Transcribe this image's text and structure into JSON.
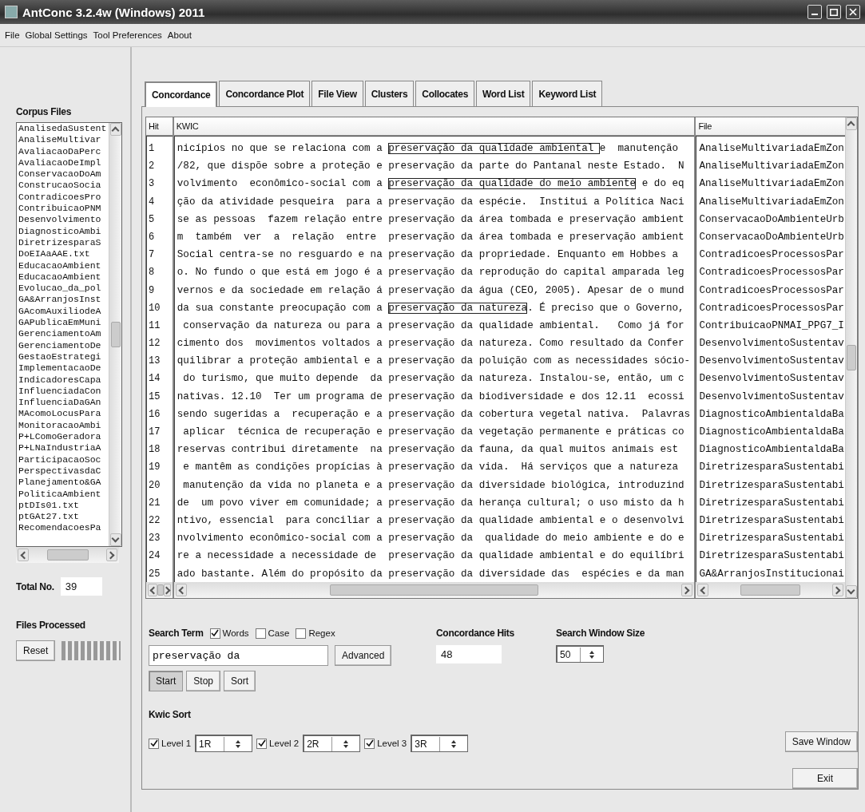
{
  "window": {
    "title": "AntConc 3.2.4w (Windows) 2011"
  },
  "menu": [
    "File",
    "Global Settings",
    "Tool Preferences",
    "About"
  ],
  "corpus": {
    "title": "Corpus Files",
    "files": [
      "AnalisedaSustent",
      "AnaliseMultivar",
      "AvaliacaoDaPerc",
      "AvaliacaoDeImpl",
      "ConservacaoDoAm",
      "ConstrucaoSocia",
      "ContradicoesPro",
      "ContribuicaoPNM",
      "Desenvolvimento",
      "DiagnosticoAmbi",
      "DiretrizesparaS",
      "DoEIAaAAE.txt",
      "EducacaoAmbient",
      "EducacaoAmbient",
      "Evolucao_da_pol",
      "GA&ArranjosInst",
      "GAcomAuxiliodeA",
      "GAPublicaEmMuni",
      "GerenciamentoAm",
      "GerenciamentoDe",
      "GestaoEstrategi",
      "ImplementacaoDe",
      "IndicadoresCapa",
      "InfluenciadaCon",
      "InfluenciaDaGAn",
      "MAcomoLocusPara",
      "MonitoracaoAmbi",
      "P+LComoGeradora",
      "P+LNaIndustriaA",
      "ParticipacaoSoc",
      "PerspectivasdaC",
      "Planejamento&GA",
      "PoliticaAmbient",
      "ptDIs01.txt",
      "ptGAt27.txt",
      "RecomendacoesPa"
    ],
    "total_label": "Total No.",
    "total": "39",
    "processed_label": "Files Processed",
    "reset": "Reset",
    "processed": {
      "level": 1
    }
  },
  "tabs": [
    {
      "label": "Concordance",
      "selected": true
    },
    {
      "label": "Concordance Plot",
      "selected": false
    },
    {
      "label": "File View",
      "selected": false
    },
    {
      "label": "Clusters",
      "selected": false
    },
    {
      "label": "Collocates",
      "selected": false
    },
    {
      "label": "Word List",
      "selected": false
    },
    {
      "label": "Keyword List",
      "selected": false
    }
  ],
  "table": {
    "columns": [
      "Hit",
      "KWIC",
      "File"
    ],
    "rows": [
      {
        "hit": "1",
        "left": "nicípios no que se relaciona com a ",
        "node": "preservação da qualidade ambiental ",
        "right": "e  manutenção",
        "boxed": true,
        "file": "AnaliseMultivariadaEmZon"
      },
      {
        "hit": "2",
        "left": "/82, que dispõe sobre a proteção e ",
        "node": "preservação da",
        "right": " parte do Pantanal neste Estado.  N",
        "boxed": false,
        "file": "AnaliseMultivariadaEmZon"
      },
      {
        "hit": "3",
        "left": "volvimento  econômico-social com a ",
        "node": "preservação da qualidade do meio ambiente",
        "right": " e do eq",
        "boxed": true,
        "file": "AnaliseMultivariadaEmZon"
      },
      {
        "hit": "4",
        "left": "ção da atividade pesqueira  para a ",
        "node": "preservação da",
        "right": " espécie.  Institui a Política Naci",
        "boxed": false,
        "file": "AnaliseMultivariadaEmZon"
      },
      {
        "hit": "5",
        "left": "se as pessoas  fazem relação entre ",
        "node": "preservação da",
        "right": " área tombada e preservação ambient",
        "boxed": false,
        "file": "ConservacaoDoAmbienteUrb"
      },
      {
        "hit": "6",
        "left": "m  também  ver  a  relação  entre  ",
        "node": "preservação da",
        "right": " área tombada e preservação ambient",
        "boxed": false,
        "file": "ConservacaoDoAmbienteUrb"
      },
      {
        "hit": "7",
        "left": "Social centra-se no resguardo e na ",
        "node": "preservação da",
        "right": " propriedade. Enquanto em Hobbes a",
        "boxed": false,
        "file": "ContradicoesProcessosPar"
      },
      {
        "hit": "8",
        "left": "o. No fundo o que está em jogo é a ",
        "node": "preservação da",
        "right": " reprodução do capital amparada leg",
        "boxed": false,
        "file": "ContradicoesProcessosPar"
      },
      {
        "hit": "9",
        "left": "vernos e da sociedade em relação á ",
        "node": "preservação da",
        "right": " água (CEO, 2005). Apesar de o mund",
        "boxed": false,
        "file": "ContradicoesProcessosPar"
      },
      {
        "hit": "10",
        "left": "da sua constante preocupação com a ",
        "node": "preservação da natureza",
        "right": ". É preciso que o Governo,",
        "boxed": true,
        "file": "ContradicoesProcessosPar"
      },
      {
        "hit": "11",
        "left": " conservação da natureza ou para a ",
        "node": "preservação da",
        "right": " qualidade ambiental.   Como já for",
        "boxed": false,
        "file": "ContribuicaoPNMAI_PPG7_I"
      },
      {
        "hit": "12",
        "left": "cimento dos  movimentos voltados a ",
        "node": "preservação da",
        "right": " natureza. Como resultado da Confer",
        "boxed": false,
        "file": "DesenvolvimentoSustentav"
      },
      {
        "hit": "13",
        "left": "quilibrar a proteção ambiental e a ",
        "node": "preservação da",
        "right": " poluição com as necessidades sócio-",
        "boxed": false,
        "file": "DesenvolvimentoSustentav"
      },
      {
        "hit": "14",
        "left": " do turismo, que muito depende  da ",
        "node": "preservação da",
        "right": " natureza. Instalou-se, então, um c",
        "boxed": false,
        "file": "DesenvolvimentoSustentav"
      },
      {
        "hit": "15",
        "left": "nativas. 12.10  Ter um programa de ",
        "node": "preservação da",
        "right": " biodiversidade e dos 12.11  ecossi",
        "boxed": false,
        "file": "DesenvolvimentoSustentav"
      },
      {
        "hit": "16",
        "left": "sendo sugeridas a  recuperação e a ",
        "node": "preservação da",
        "right": " cobertura vegetal nativa.  Palavras",
        "boxed": false,
        "file": "DiagnosticoAmbientaldaBa"
      },
      {
        "hit": "17",
        "left": " aplicar  técnica de recuperação e ",
        "node": "preservação da",
        "right": " vegetação permanente e práticas co",
        "boxed": false,
        "file": "DiagnosticoAmbientaldaBa"
      },
      {
        "hit": "18",
        "left": "reservas contribui diretamente  na ",
        "node": "preservação da",
        "right": " fauna, da qual muitos animais est",
        "boxed": false,
        "file": "DiagnosticoAmbientaldaBa"
      },
      {
        "hit": "19",
        "left": " e mantêm as condições propícias à ",
        "node": "preservação da",
        "right": " vida.  Há serviços que a natureza",
        "boxed": false,
        "file": "DiretrizesparaSustentabi"
      },
      {
        "hit": "20",
        "left": " manutenção da vida no planeta e a ",
        "node": "preservação da",
        "right": " diversidade biológica, introduzind",
        "boxed": false,
        "file": "DiretrizesparaSustentabi"
      },
      {
        "hit": "21",
        "left": "de  um povo viver em comunidade; a ",
        "node": "preservação da",
        "right": " herança cultural; o uso misto da h",
        "boxed": false,
        "file": "DiretrizesparaSustentabi"
      },
      {
        "hit": "22",
        "left": "ntivo, essencial  para conciliar a ",
        "node": "preservação da",
        "right": " qualidade ambiental e o desenvolvi",
        "boxed": false,
        "file": "DiretrizesparaSustentabi"
      },
      {
        "hit": "23",
        "left": "nvolvimento econômico-social com a ",
        "node": "preservação da",
        "right": "  qualidade do meio ambiente e do e",
        "boxed": false,
        "file": "DiretrizesparaSustentabi"
      },
      {
        "hit": "24",
        "left": "re a necessidade a necessidade de  ",
        "node": "preservação da",
        "right": " qualidade ambiental e do equilíbri",
        "boxed": false,
        "file": "DiretrizesparaSustentabi"
      },
      {
        "hit": "25",
        "left": "ado bastante. Além do propósito da ",
        "node": "preservação da",
        "right": " diversidade das  espécies e da man",
        "boxed": false,
        "file": "GA&ArranjosInstitucionai"
      }
    ]
  },
  "search": {
    "label": "Search Term",
    "options": [
      {
        "label": "Words",
        "checked": true
      },
      {
        "label": "Case",
        "checked": false
      },
      {
        "label": "Regex",
        "checked": false
      }
    ],
    "value": "preservação da",
    "advanced": "Advanced",
    "buttons": [
      {
        "label": "Start",
        "pressed": true
      },
      {
        "label": "Stop",
        "pressed": false
      },
      {
        "label": "Sort",
        "pressed": false
      }
    ]
  },
  "hits": {
    "label": "Concordance Hits",
    "value": "48"
  },
  "window_size": {
    "label": "Search Window Size",
    "value": "50"
  },
  "kwic_sort": {
    "label": "Kwic Sort",
    "levels": [
      {
        "label": "Level 1",
        "checked": true,
        "value": "1R"
      },
      {
        "label": "Level 2",
        "checked": true,
        "value": "2R"
      },
      {
        "label": "Level 3",
        "checked": true,
        "value": "3R"
      }
    ]
  },
  "actions": [
    "Save Window",
    "Exit"
  ]
}
